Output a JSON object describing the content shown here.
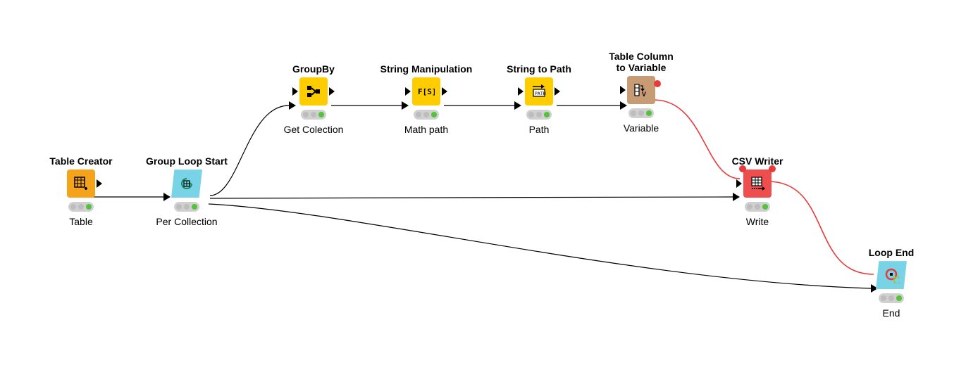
{
  "nodes": {
    "table_creator": {
      "title": "Table Creator",
      "caption": "Table",
      "color": "#f5a31a",
      "icon": "table-plus"
    },
    "group_loop_start": {
      "title": "Group Loop Start",
      "caption": "Per Collection",
      "color": "#79d3e6",
      "icon": "loop-start"
    },
    "groupby": {
      "title": "GroupBy",
      "caption": "Get Colection",
      "color": "#ffcc00",
      "icon": "groupby"
    },
    "string_manipulation": {
      "title": "String Manipulation",
      "caption": "Math path",
      "color": "#ffcc00",
      "icon": "fs"
    },
    "string_to_path": {
      "title": "String to Path",
      "caption": "Path",
      "color": "#ffcc00",
      "icon": "path"
    },
    "table_col_to_var": {
      "title": "Table Column\nto Variable",
      "caption": "Variable",
      "color": "#c79b73",
      "icon": "to-var"
    },
    "csv_writer": {
      "title": "CSV Writer",
      "caption": "Write",
      "color": "#ef4e4e",
      "icon": "csv"
    },
    "loop_end": {
      "title": "Loop End",
      "caption": "End",
      "color": "#79d3e6",
      "icon": "loop-end"
    }
  }
}
